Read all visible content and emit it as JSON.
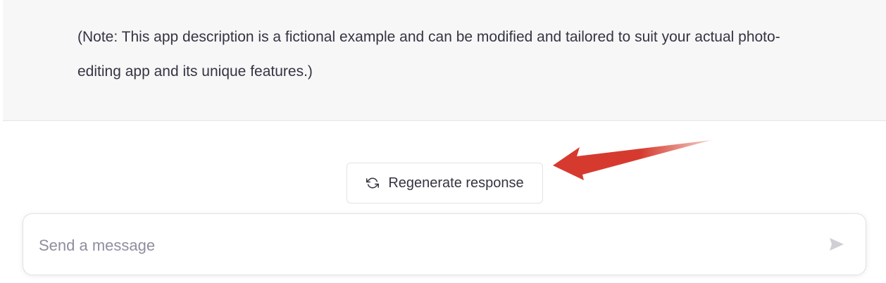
{
  "message": {
    "text": "(Note: This app description is a fictional example and can be modified and tailored to suit your actual photo-editing app and its unique features.)"
  },
  "actions": {
    "regenerate_label": "Regenerate response",
    "regenerate_icon": "refresh-icon"
  },
  "annotation": {
    "arrow_icon": "red-arrow-pointer",
    "arrow_color": "#d63a2f"
  },
  "composer": {
    "placeholder": "Send a message",
    "value": "",
    "send_icon": "send-icon",
    "send_icon_color": "#cfcfd6"
  }
}
